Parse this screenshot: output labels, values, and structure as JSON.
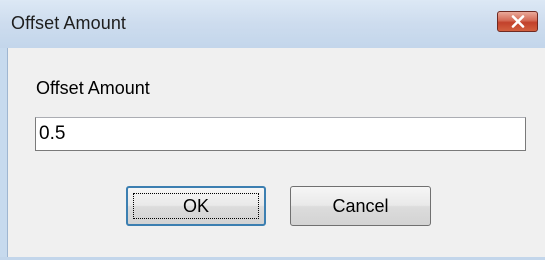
{
  "dialog": {
    "title": "Offset Amount",
    "close_icon": "close-icon",
    "field_label": "Offset Amount",
    "field_value": "0.5",
    "ok_label": "OK",
    "cancel_label": "Cancel"
  },
  "colors": {
    "titlebar": "#c9daee",
    "client_background": "#f0f0f0",
    "close_button": "#c2412b",
    "default_button_border": "#3c7fb1"
  }
}
